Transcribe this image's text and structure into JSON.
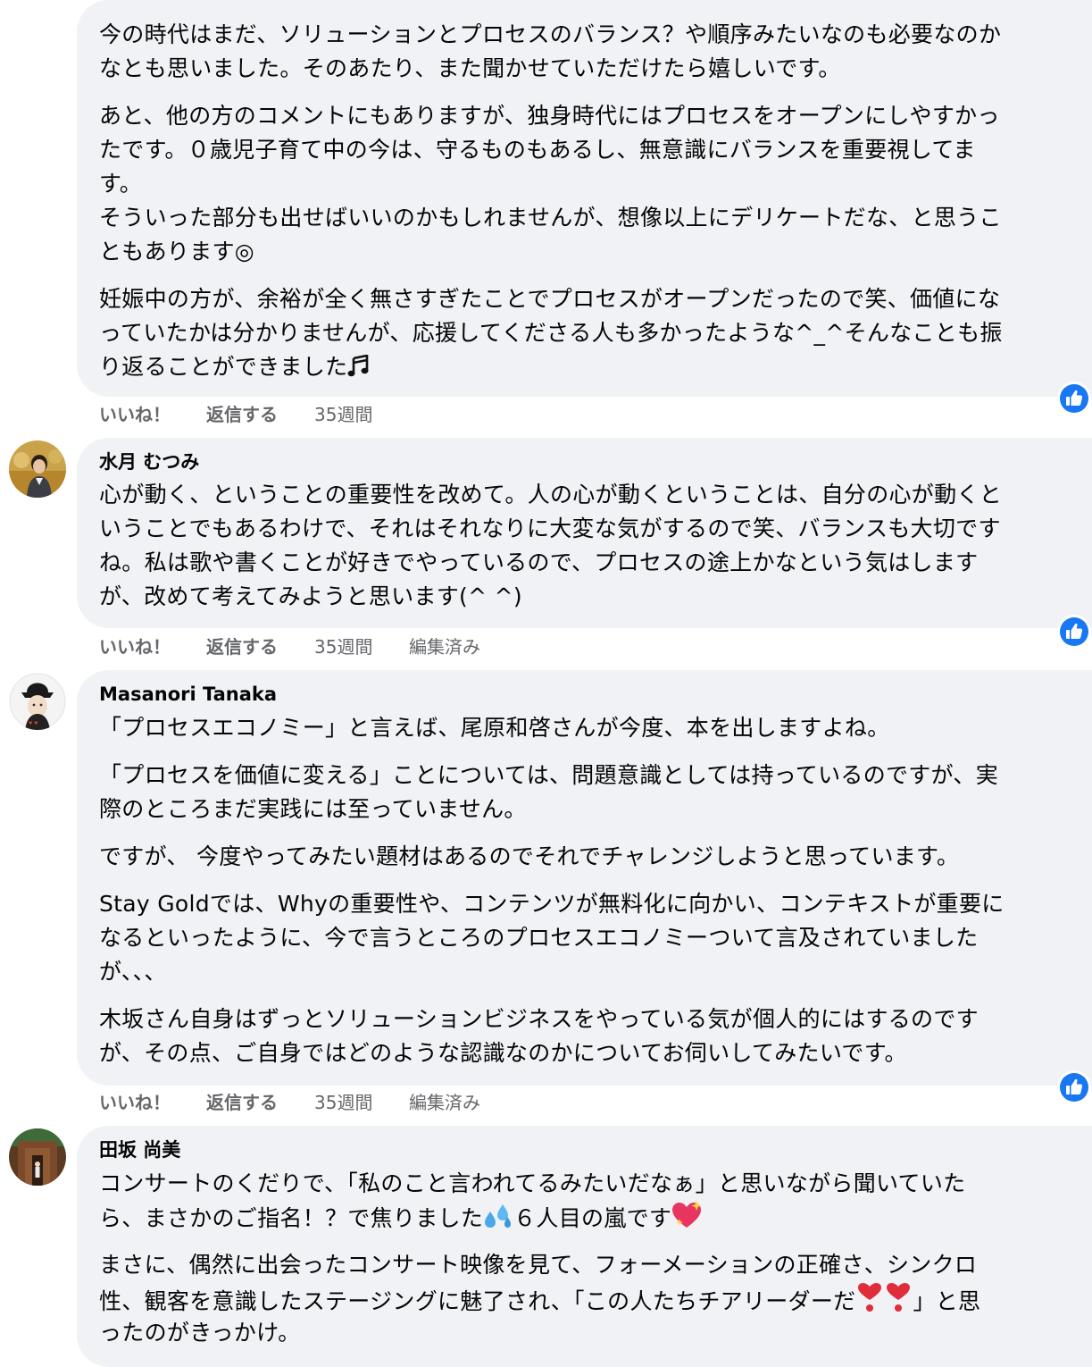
{
  "colors": {
    "bubble": "#f0f2f5",
    "text": "#050505",
    "meta": "#65676b",
    "like_blue": "#1877f2"
  },
  "icons": {
    "like_badge": "thumbs-up-icon",
    "music": "music-note-icon",
    "sweat": "sweat-droplets-icon",
    "heart_sparkle": "sparkling-heart-icon",
    "heart_exclamation": "heart-exclamation-icon"
  },
  "comments": [
    {
      "author": "",
      "paragraphs": [
        [
          "今の時代はまだ、ソリューションとプロセスのバランス？や順序みたいなのも必要なのか",
          "なとも思いました。そのあたり、また聞かせていただけたら嬉しいです。"
        ],
        [
          "あと、他の方のコメントにもありますが、独身時代にはプロセスをオープンにしやすかっ",
          "たです。０歳児子育て中の今は、守るものもあるし、無意識にバランスを重要視してま",
          "す。",
          "そういった部分も出せばいいのかもしれませんが、想像以上にデリケートだな、と思うこ",
          "ともあります◎"
        ],
        [
          "妊娠中の方が、余裕が全く無さすぎたことでプロセスがオープンだったので笑、価値にな",
          "っていたかは分かりませんが、応援してくださる人も多かったような^_^そんなことも振",
          "り返ることができました"
        ]
      ],
      "like_label": "いいね！",
      "reply_label": "返信する",
      "time": "35週間",
      "edited": ""
    },
    {
      "author": "水月 むつみ",
      "paragraphs": [
        [
          "心が動く、ということの重要性を改めて。人の心が動くということは、自分の心が動くと",
          "いうことでもあるわけで、それはそれなりに大変な気がするので笑、バランスも大切です",
          "ね。私は歌や書くことが好きでやっているので、プロセスの途上かなという気はします",
          "が、改めて考えてみようと思います(^ ^)"
        ]
      ],
      "like_label": "いいね！",
      "reply_label": "返信する",
      "time": "35週間",
      "edited": "編集済み"
    },
    {
      "author": "Masanori Tanaka",
      "paragraphs": [
        [
          "「プロセスエコノミー」と言えば、尾原和啓さんが今度、本を出しますよね。"
        ],
        [
          "「プロセスを価値に変える」ことについては、問題意識としては持っているのですが、実",
          "際のところまだ実践には至っていません。"
        ],
        [
          "ですが、 今度やってみたい題材はあるのでそれでチャレンジしようと思っています。"
        ],
        [
          "Stay Goldでは、Whyの重要性や、コンテンツが無料化に向かい、コンテキストが重要に",
          "なるといったように、今で言うところのプロセスエコノミーついて言及されていました",
          "が、、、"
        ],
        [
          "木坂さん自身はずっとソリューションビジネスをやっている気が個人的にはするのです",
          "が、その点、ご自身ではどのような認識なのかについてお伺いしてみたいです。"
        ]
      ],
      "like_label": "いいね！",
      "reply_label": "返信する",
      "time": "35週間",
      "edited": "編集済み"
    },
    {
      "author": "田坂 尚美",
      "paragraphs": [
        [
          "コンサートのくだりで、「私のこと言われてるみたいだなぁ」と思いながら聞いていた",
          "ら、まさかのご指名！？で焦りました",
          "６人目の嵐です"
        ],
        [
          "まさに、偶然に出会ったコンサート映像を見て、フォーメーションの正確さ、シンクロ",
          "性、観客を意識したステージングに魅了され、「この人たちチアリーダーだ",
          "」と思",
          "ったのがきっかけ。"
        ]
      ]
    }
  ]
}
